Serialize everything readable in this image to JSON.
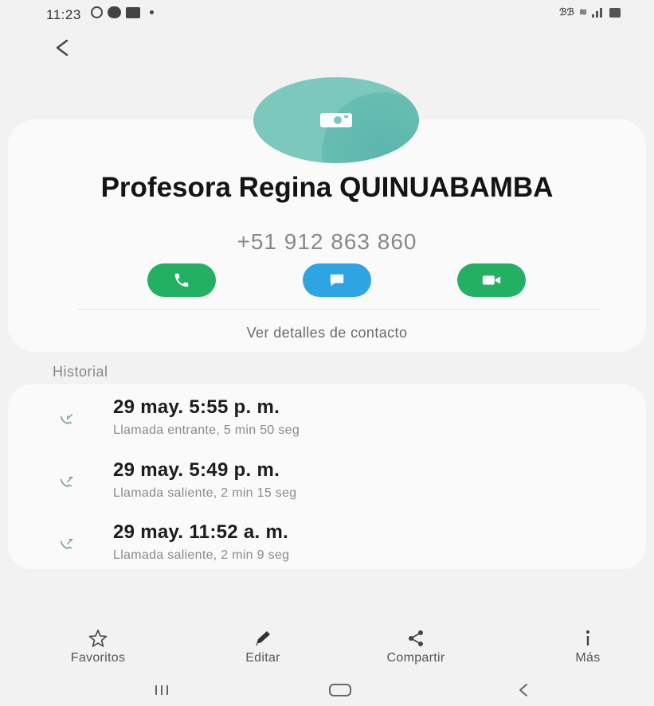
{
  "status_bar": {
    "time": "11:23",
    "right_text": "ℬℬ",
    "icons": [
      "whatsapp-icon",
      "notification-icon",
      "message-icon",
      "dot-icon",
      "data-icon",
      "wifi-icon",
      "signal-icon",
      "battery-icon"
    ]
  },
  "contact": {
    "name": "Profesora Regina QUINUABAMBA",
    "phone": "+51 912 863 860",
    "avatar_color": "#7cc8bd",
    "details_link": "Ver detalles de contacto"
  },
  "actions": {
    "call_color": "#23b063",
    "message_color": "#2ea4e2",
    "video_color": "#23b063"
  },
  "history": {
    "label": "Historial",
    "calls": [
      {
        "date": "29 may. 5:55 p. m.",
        "detail": "Llamada entrante, 5 min 50 seg",
        "icon": "incoming-call-icon"
      },
      {
        "date": "29 may. 5:49 p. m.",
        "detail": "Llamada saliente, 2 min 15 seg",
        "icon": "outgoing-call-icon"
      },
      {
        "date": "29 may. 11:52 a. m.",
        "detail": "Llamada saliente, 2 min 9 seg",
        "icon": "outgoing-call-icon"
      }
    ]
  },
  "bottom_bar": {
    "favorites": "Favoritos",
    "edit": "Editar",
    "share": "Compartir",
    "more": "Más"
  }
}
